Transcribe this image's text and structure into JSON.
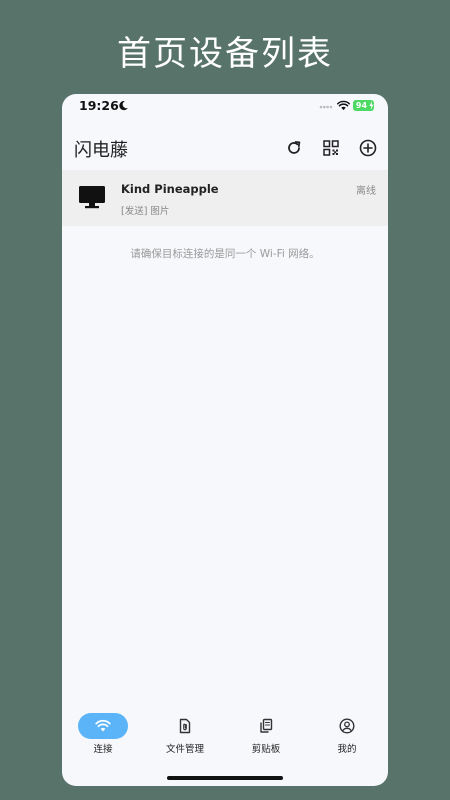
{
  "promo": {
    "title": "首页设备列表"
  },
  "status_bar": {
    "time": "19:26",
    "battery": "94"
  },
  "header": {
    "title": "闪电藤"
  },
  "devices": [
    {
      "name": "Kind Pineapple",
      "status": "离线",
      "last": "[发送] 图片",
      "icon": "monitor-icon"
    }
  ],
  "hint": "请确保目标连接的是同一个 Wi-Fi 网络。",
  "tabs": [
    {
      "label": "连接",
      "icon": "wifi-icon",
      "active": true
    },
    {
      "label": "文件管理",
      "icon": "file-attachment-icon",
      "active": false
    },
    {
      "label": "剪贴板",
      "icon": "clipboard-icon",
      "active": false
    },
    {
      "label": "我的",
      "icon": "user-icon",
      "active": false
    }
  ],
  "colors": {
    "background": "#57736a",
    "accent": "#5ab4f7",
    "battery": "#4cd964"
  }
}
